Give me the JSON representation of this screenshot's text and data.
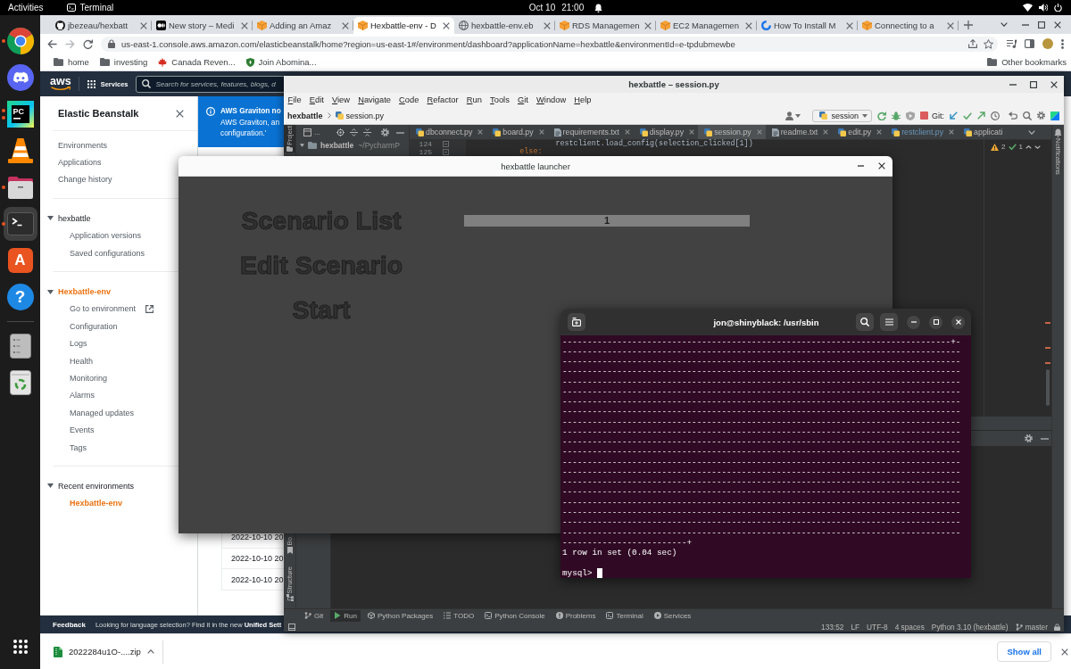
{
  "top_bar": {
    "activities": "Activities",
    "app_name": "Terminal",
    "date": "Oct 10",
    "time": "21:00"
  },
  "dock": {
    "apps": [
      {
        "kind": "chrome",
        "running": true,
        "multiple_windows": false,
        "selected": false
      },
      {
        "kind": "discord",
        "running": false,
        "multiple_windows": false,
        "selected": false
      },
      {
        "kind": "pycharm",
        "label": "PC",
        "running": true,
        "multiple_windows": true,
        "selected": false
      },
      {
        "kind": "vlc",
        "running": false,
        "multiple_windows": false,
        "selected": false
      },
      {
        "kind": "files",
        "running": true,
        "multiple_windows": false,
        "selected": false
      },
      {
        "kind": "terminal",
        "running": true,
        "multiple_windows": false,
        "selected": true
      },
      {
        "kind": "software",
        "label": "A",
        "running": false,
        "multiple_windows": false,
        "selected": false
      },
      {
        "kind": "help",
        "label": "?",
        "running": false,
        "multiple_windows": false,
        "selected": false
      }
    ],
    "places": [
      {
        "kind": "drive"
      },
      {
        "kind": "trash"
      }
    ]
  },
  "browser": {
    "tabs": [
      {
        "kind": "github",
        "title": "jbezeau/hexbatt",
        "selected": false
      },
      {
        "kind": "medium",
        "title": "New story – Medi",
        "selected": false
      },
      {
        "kind": "aws",
        "title": "Adding an Amaz",
        "selected": false
      },
      {
        "kind": "aws",
        "title": "Hexbattle-env - D",
        "selected": true
      },
      {
        "kind": "globe",
        "title": "hexbattle-env.eb",
        "selected": false
      },
      {
        "kind": "aws",
        "title": "RDS Managemen",
        "selected": false
      },
      {
        "kind": "aws",
        "title": "EC2 Managemen",
        "selected": false
      },
      {
        "kind": "guide",
        "title": "How To Install M",
        "selected": false
      },
      {
        "kind": "aws",
        "title": "Connecting to a",
        "selected": false
      }
    ],
    "url": "us-east-1.console.aws.amazon.com/elasticbeanstalk/home?region=us-east-1#/environment/dashboard?applicationName=hexbattle&environmentId=e-tpdubmewbe",
    "bookmarks": [
      {
        "kind": "folder",
        "label": "home"
      },
      {
        "kind": "folder",
        "label": "investing"
      },
      {
        "kind": "leaf",
        "label": "Canada Reven..."
      },
      {
        "kind": "shield",
        "label": "Join Abomina..."
      }
    ],
    "other_bookmarks": "Other bookmarks",
    "download": {
      "file": "2022284u1O-....zip",
      "show_all": "Show all"
    }
  },
  "aws": {
    "logo": "aws",
    "services": "Services",
    "search": {
      "placeholder": "Search for services, features, blogs, d"
    },
    "sidebar": {
      "title": "Elastic Beanstalk",
      "links": [
        {
          "label": "Environments",
          "selected": false
        },
        {
          "label": "Applications",
          "selected": false
        },
        {
          "label": "Change history",
          "selected": false
        }
      ],
      "groups": [
        {
          "heading": "hexbattle",
          "expanded": true,
          "selected": false,
          "items": [
            {
              "label": "Application versions",
              "kind": "link",
              "selected": false
            },
            {
              "label": "Saved configurations",
              "kind": "link",
              "selected": false
            }
          ]
        },
        {
          "heading": "Hexbattle-env",
          "expanded": true,
          "selected": true,
          "items": [
            {
              "label": "Go to environment",
              "kind": "external",
              "selected": false
            },
            {
              "label": "Configuration",
              "kind": "link",
              "selected": false
            },
            {
              "label": "Logs",
              "kind": "link",
              "selected": false
            },
            {
              "label": "Health",
              "kind": "link",
              "selected": false
            },
            {
              "label": "Monitoring",
              "kind": "link",
              "selected": false
            },
            {
              "label": "Alarms",
              "kind": "link",
              "selected": false
            },
            {
              "label": "Managed updates",
              "kind": "link",
              "selected": false
            },
            {
              "label": "Events",
              "kind": "link",
              "selected": false
            },
            {
              "label": "Tags",
              "kind": "link",
              "selected": false
            }
          ]
        },
        {
          "heading": "Recent environments",
          "expanded": true,
          "selected": false,
          "items": [
            {
              "label": "Hexbattle-env",
              "kind": "link",
              "selected": true
            }
          ]
        }
      ]
    },
    "banner": {
      "title": "AWS Graviton no",
      "lines": [
        "AWS Graviton, an",
        "configuration.'"
      ]
    },
    "table": {
      "rows": [
        {
          "column_1": "2022-10-10 20"
        },
        {
          "column_1": "2022-10-10 20"
        },
        {
          "column_1": "2022-10-10 20"
        }
      ]
    },
    "footer": {
      "feedback": "Feedback",
      "notice": "Looking for language selection? Find it in the new **Unified Sett**"
    }
  },
  "pycharm": {
    "title": "hexbattle – session.py",
    "menu": [
      "File",
      "Edit",
      "View",
      "Navigate",
      "Code",
      "Refactor",
      "Run",
      "Tools",
      "Git",
      "Window",
      "Help"
    ],
    "breadcrumbs": [
      {
        "kind": "project",
        "label": "hexbattle"
      },
      {
        "kind": "python",
        "label": "session.py"
      }
    ],
    "run_config": "session",
    "git_label": "Git:",
    "left_stripe": {
      "top": [
        {
          "kind": "project",
          "label": "Project",
          "selected": true
        }
      ],
      "bottom": [
        {
          "kind": "bookmarks",
          "label": "Bo",
          "selected": false
        },
        {
          "kind": "structure",
          "label": "Structure",
          "selected": false
        }
      ]
    },
    "right_stripe": {
      "label": "Notifications"
    },
    "project_view": {
      "title": "...",
      "tree": [
        {
          "label": "hexbattle",
          "path": "~/PycharmP",
          "expanded": true
        }
      ]
    },
    "editor_tabs": [
      {
        "kind": "python",
        "label": "dbconnect.py",
        "selected": false,
        "modified": false
      },
      {
        "kind": "python",
        "label": "board.py",
        "selected": false,
        "modified": false
      },
      {
        "kind": "text",
        "label": "requirements.txt",
        "selected": false,
        "modified": false
      },
      {
        "kind": "python",
        "label": "display.py",
        "selected": false,
        "modified": false
      },
      {
        "kind": "python",
        "label": "session.py",
        "selected": true,
        "modified": false
      },
      {
        "kind": "text",
        "label": "readme.txt",
        "selected": false,
        "modified": false
      },
      {
        "kind": "python",
        "label": "edit.py",
        "selected": false,
        "modified": false
      },
      {
        "kind": "python",
        "label": "restclient.py",
        "selected": false,
        "modified": true
      },
      {
        "kind": "python",
        "label": "applicati",
        "selected": false,
        "modified": false
      }
    ],
    "code": [
      {
        "number": "124",
        "text": "                    restclient.load_config(selection_clicked[1])",
        "kind": "plain",
        "fold": true
      },
      {
        "number": "125",
        "text": "            else:",
        "kind": "keyword",
        "fold": true
      }
    ],
    "inspections": {
      "warnings": "2",
      "passed": "1"
    },
    "tool_tabs": [
      {
        "kind": "git",
        "label": "Git",
        "selected": false
      },
      {
        "kind": "run",
        "label": "Run",
        "selected": true
      },
      {
        "kind": "packages",
        "label": "Python Packages",
        "selected": false
      },
      {
        "kind": "todo",
        "label": "TODO",
        "selected": false
      },
      {
        "kind": "console",
        "label": "Python Console",
        "selected": false
      },
      {
        "kind": "problems",
        "label": "Problems",
        "selected": false
      },
      {
        "kind": "terminal",
        "label": "Terminal",
        "selected": false
      },
      {
        "kind": "services",
        "label": "Services",
        "selected": false
      }
    ],
    "status": {
      "items": [
        "133:52",
        "LF",
        "UTF-8",
        "4 spaces",
        "Python 3.10 (hexbattle)"
      ],
      "branch": "master"
    }
  },
  "launcher": {
    "title": "hexbattle launcher",
    "options": [
      "Scenario List",
      "Edit Scenario",
      "Start"
    ],
    "scenarios": [
      {
        "label": "1"
      }
    ]
  },
  "terminal": {
    "title": "jon@shinyblack: /usr/sbin",
    "output": [
      "------------------------------------------------------------------------------+-",
      "--------------------------------------------------------------------------------",
      "--------------------------------------------------------------------------------",
      "--------------------------------------------------------------------------------",
      "--------------------------------------------------------------------------------",
      "--------------------------------------------------------------------------------",
      "--------------------------------------------------------------------------------",
      "--------------------------------------------------------------------------------",
      "--------------------------------------------------------------------------------",
      "--------------------------------------------------------------------------------",
      "--------------------------------------------------------------------------------",
      "--------------------------------------------------------------------------------",
      "--------------------------------------------------------------------------------",
      "--------------------------------------------------------------------------------",
      "--------------------------------------------------------------------------------",
      "--------------------------------------------------------------------------------",
      "--------------------------------------------------------------------------------",
      "--------------------------------------------------------------------------------",
      "--------------------------------------------------------------------------------",
      "--------------------------------------------------------------------------------",
      "-------------------------+",
      "1 row in set (0.04 sec)"
    ],
    "prompt": "mysql>"
  }
}
